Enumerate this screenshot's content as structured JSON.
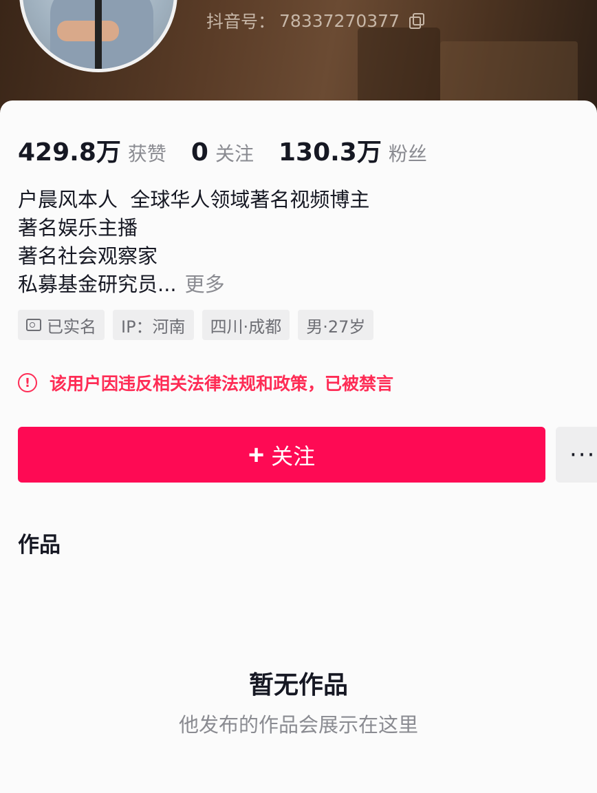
{
  "header": {
    "douyin_id_label": "抖音号：",
    "douyin_id_value": "78337270377",
    "copy_icon": "copy-icon"
  },
  "stats": {
    "likes_value": "429.8万",
    "likes_label": "获赞",
    "following_value": "0",
    "following_label": "关注",
    "followers_value": "130.3万",
    "followers_label": "粉丝"
  },
  "bio": {
    "line1": "户晨风本人  全球华人领域著名视频博主",
    "line2": "著名娱乐主播",
    "line3": "著名社会观察家",
    "line4": "私募基金研究员...",
    "more": "更多"
  },
  "tags": {
    "verified": "已实名",
    "ip": "IP：河南",
    "location": "四川·成都",
    "gender_age": "男·27岁"
  },
  "warning": {
    "icon": "!",
    "text": "该用户因违反相关法律法规和政策，已被禁言"
  },
  "actions": {
    "follow_plus": "+",
    "follow_label": "关注",
    "more_label": "···"
  },
  "works": {
    "title": "作品",
    "empty_title": "暂无作品",
    "empty_sub": "他发布的作品会展示在这里"
  },
  "colors": {
    "accent": "#fe0a54",
    "warning": "#fe2c55",
    "secondary_text": "#8a8b91"
  }
}
